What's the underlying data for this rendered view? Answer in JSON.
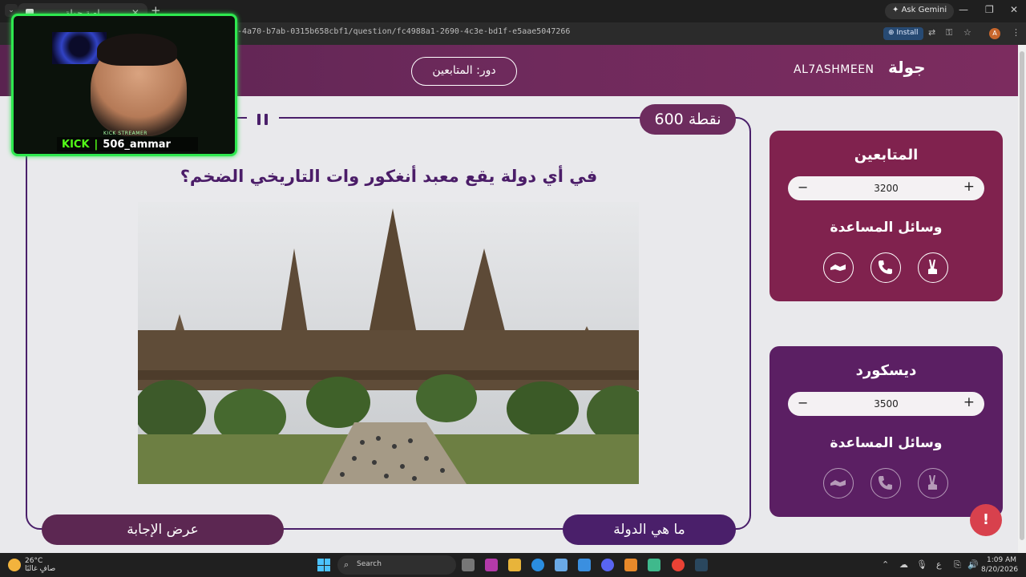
{
  "browser": {
    "tab_title": "لعبة جولة",
    "url_fragment": "-4a70-b7ab-0315b658cbf1/question/fc4988a1-2690-4c3e-bd1f-e5aae5047266",
    "ask_gemini": "Ask Gemini",
    "install": "Install",
    "profile_initial": "A"
  },
  "header": {
    "turn_label": "دور: المتابعين",
    "team_name": "AL7ASHMEEN",
    "logo": "جولة"
  },
  "question": {
    "points": "600 نقطة",
    "text": "في أي دولة يقع معبد أنغكور وات التاريخي الضخم؟",
    "show_answer": "عرض الإجابة",
    "what_country": "ما هي الدولة"
  },
  "teams": [
    {
      "name": "المتابعين",
      "score": "3200",
      "helps_title": "وسائل المساعدة",
      "color": "#80224e"
    },
    {
      "name": "ديسكورد",
      "score": "3500",
      "helps_title": "وسائل المساعدة",
      "color": "#5b1f63"
    }
  ],
  "stepper": {
    "minus": "−",
    "plus": "+"
  },
  "webcam": {
    "streamer_label": "KICK STREAMER",
    "platform": "KICK",
    "username": "506_ammar"
  },
  "taskbar": {
    "temperature": "26°C",
    "weather_desc": "صافٍ غالبًا",
    "search_placeholder": "Search",
    "lang": "ع",
    "time": "1:09 AM",
    "date": "8/20/2026"
  }
}
